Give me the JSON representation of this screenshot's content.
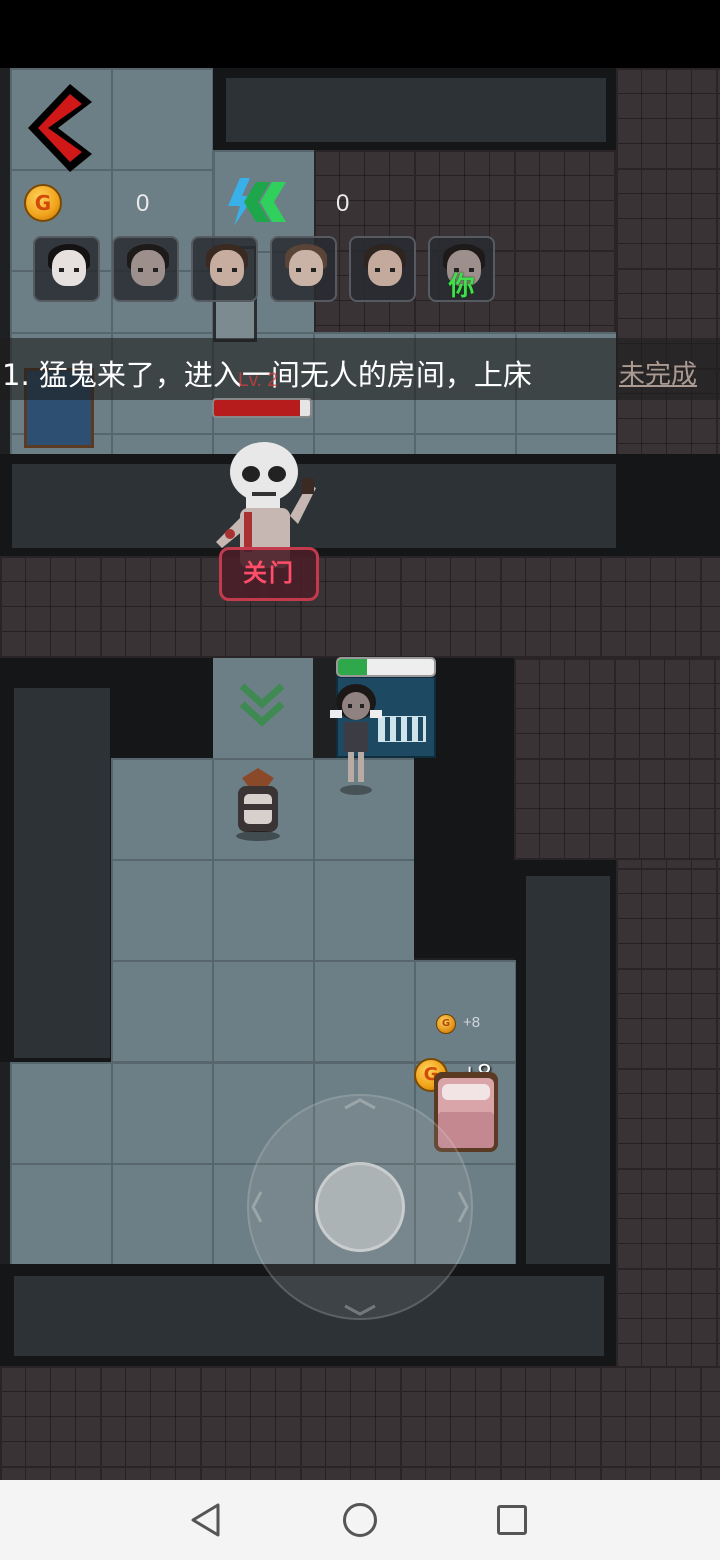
{
  "hud": {
    "coins": "0",
    "energy": "0",
    "coin_symbol": "G"
  },
  "avatars": [
    {
      "name": "ghost-girl-avatar",
      "label": ""
    },
    {
      "name": "bow-girl-avatar",
      "label": ""
    },
    {
      "name": "girl-avatar",
      "label": ""
    },
    {
      "name": "boy-avatar",
      "label": ""
    },
    {
      "name": "girl-2-avatar",
      "label": ""
    },
    {
      "name": "self-avatar",
      "label": "你"
    }
  ],
  "task": {
    "text": "1. 猛鬼来了，进入一间无人的房间，上床",
    "status": "未完成"
  },
  "ghost": {
    "level": "Lv. 2",
    "hp_fraction": 0.9
  },
  "actions": {
    "close_door": "关门"
  },
  "player": {
    "hp_fraction": 0.3
  },
  "coin_popups": {
    "small": "+8",
    "large": "+8"
  },
  "colors": {
    "accent_red": "#c62828",
    "task_status": "#aa9a92",
    "self_label": "#3fe04a",
    "close_door_border": "#c23a4c"
  }
}
